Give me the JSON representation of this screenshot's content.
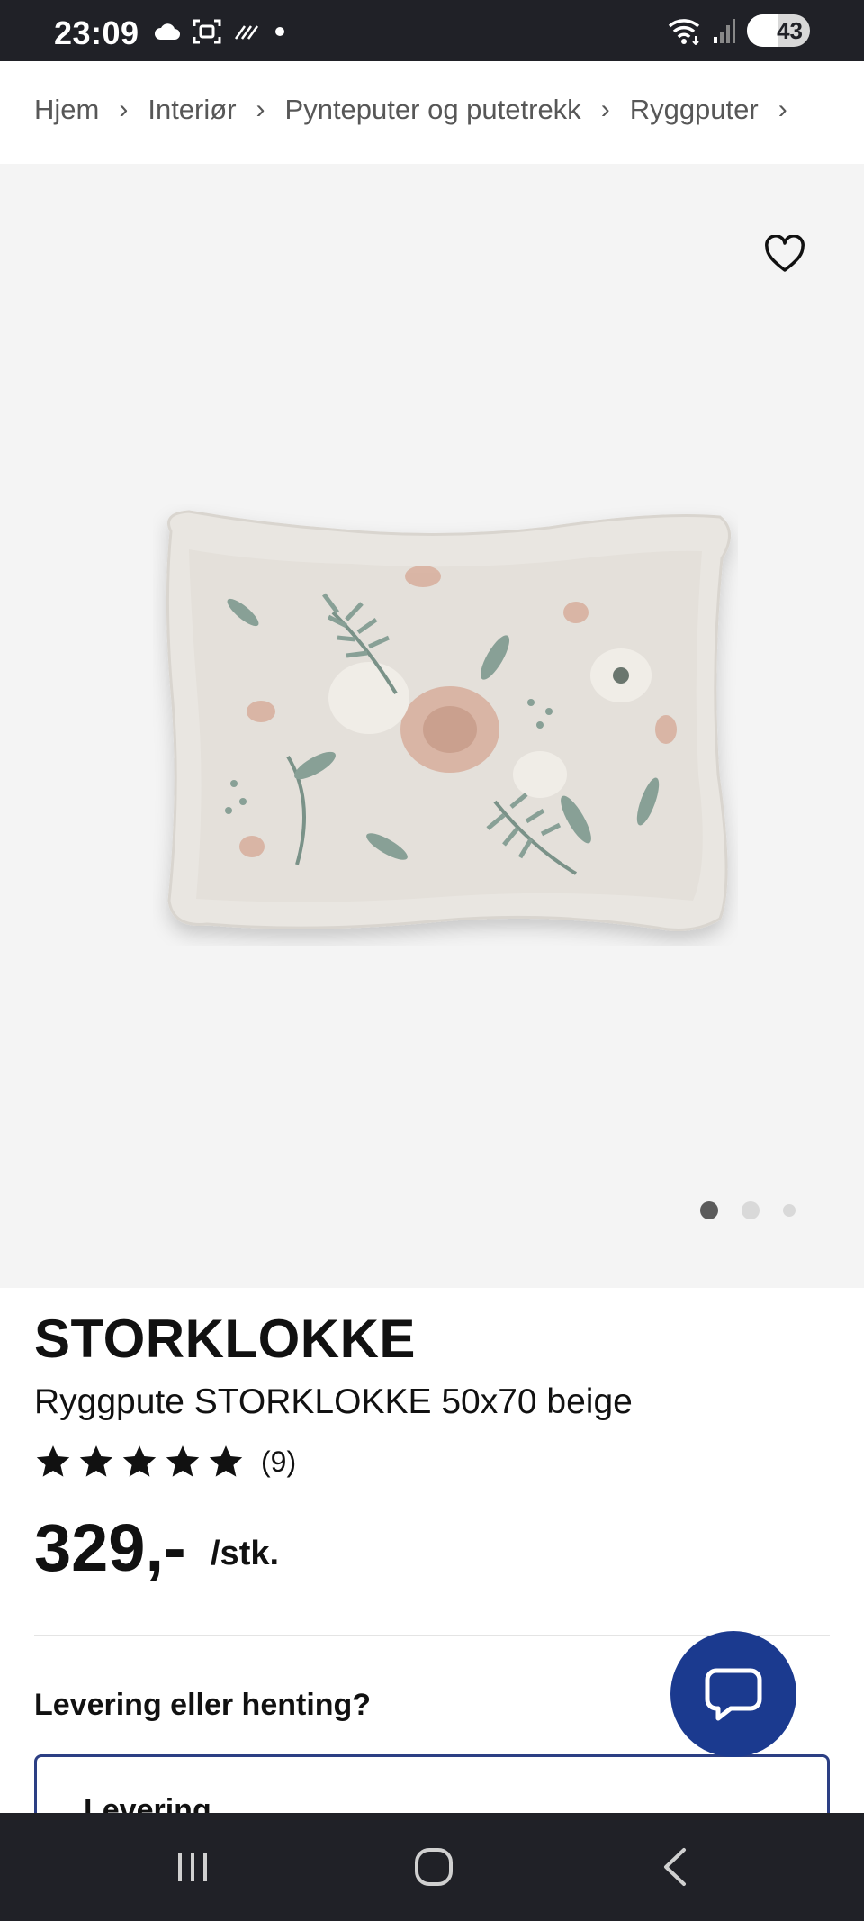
{
  "status_bar": {
    "time": "23:09",
    "battery": "43",
    "left_icons": [
      "cloud-icon",
      "screenshot-icon",
      "nfc-icon",
      "dot-icon"
    ],
    "right_icons": [
      "wifi-icon",
      "signal-icon",
      "battery-icon"
    ]
  },
  "breadcrumb": {
    "items": [
      "Hjem",
      "Interiør",
      "Pynteputer og putetrekk",
      "Ryggputer"
    ],
    "separator": "›"
  },
  "gallery": {
    "image_count": 3,
    "active_index": 0
  },
  "product": {
    "brand": "STORKLOKKE",
    "name": "Ryggpute STORKLOKKE 50x70 beige",
    "rating_stars": 5,
    "review_count": "(9)",
    "price": "329,-",
    "unit": "/stk."
  },
  "delivery": {
    "heading": "Levering eller henting?",
    "option_label": "Levering"
  },
  "colors": {
    "status_bar_bg": "#202127",
    "image_bg": "#f4f4f4",
    "accent_blue": "#1b3a8f",
    "card_border": "#2c3f84"
  }
}
